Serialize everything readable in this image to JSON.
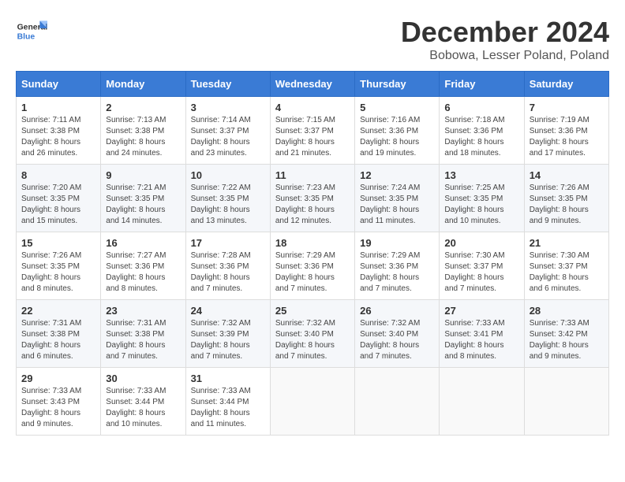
{
  "header": {
    "logo_line1": "General",
    "logo_line2": "Blue",
    "month": "December 2024",
    "location": "Bobowa, Lesser Poland, Poland"
  },
  "weekdays": [
    "Sunday",
    "Monday",
    "Tuesday",
    "Wednesday",
    "Thursday",
    "Friday",
    "Saturday"
  ],
  "weeks": [
    [
      {
        "day": "1",
        "sunrise": "7:11 AM",
        "sunset": "3:38 PM",
        "daylight": "8 hours and 26 minutes."
      },
      {
        "day": "2",
        "sunrise": "7:13 AM",
        "sunset": "3:38 PM",
        "daylight": "8 hours and 24 minutes."
      },
      {
        "day": "3",
        "sunrise": "7:14 AM",
        "sunset": "3:37 PM",
        "daylight": "8 hours and 23 minutes."
      },
      {
        "day": "4",
        "sunrise": "7:15 AM",
        "sunset": "3:37 PM",
        "daylight": "8 hours and 21 minutes."
      },
      {
        "day": "5",
        "sunrise": "7:16 AM",
        "sunset": "3:36 PM",
        "daylight": "8 hours and 19 minutes."
      },
      {
        "day": "6",
        "sunrise": "7:18 AM",
        "sunset": "3:36 PM",
        "daylight": "8 hours and 18 minutes."
      },
      {
        "day": "7",
        "sunrise": "7:19 AM",
        "sunset": "3:36 PM",
        "daylight": "8 hours and 17 minutes."
      }
    ],
    [
      {
        "day": "8",
        "sunrise": "7:20 AM",
        "sunset": "3:35 PM",
        "daylight": "8 hours and 15 minutes."
      },
      {
        "day": "9",
        "sunrise": "7:21 AM",
        "sunset": "3:35 PM",
        "daylight": "8 hours and 14 minutes."
      },
      {
        "day": "10",
        "sunrise": "7:22 AM",
        "sunset": "3:35 PM",
        "daylight": "8 hours and 13 minutes."
      },
      {
        "day": "11",
        "sunrise": "7:23 AM",
        "sunset": "3:35 PM",
        "daylight": "8 hours and 12 minutes."
      },
      {
        "day": "12",
        "sunrise": "7:24 AM",
        "sunset": "3:35 PM",
        "daylight": "8 hours and 11 minutes."
      },
      {
        "day": "13",
        "sunrise": "7:25 AM",
        "sunset": "3:35 PM",
        "daylight": "8 hours and 10 minutes."
      },
      {
        "day": "14",
        "sunrise": "7:26 AM",
        "sunset": "3:35 PM",
        "daylight": "8 hours and 9 minutes."
      }
    ],
    [
      {
        "day": "15",
        "sunrise": "7:26 AM",
        "sunset": "3:35 PM",
        "daylight": "8 hours and 8 minutes."
      },
      {
        "day": "16",
        "sunrise": "7:27 AM",
        "sunset": "3:36 PM",
        "daylight": "8 hours and 8 minutes."
      },
      {
        "day": "17",
        "sunrise": "7:28 AM",
        "sunset": "3:36 PM",
        "daylight": "8 hours and 7 minutes."
      },
      {
        "day": "18",
        "sunrise": "7:29 AM",
        "sunset": "3:36 PM",
        "daylight": "8 hours and 7 minutes."
      },
      {
        "day": "19",
        "sunrise": "7:29 AM",
        "sunset": "3:36 PM",
        "daylight": "8 hours and 7 minutes."
      },
      {
        "day": "20",
        "sunrise": "7:30 AM",
        "sunset": "3:37 PM",
        "daylight": "8 hours and 7 minutes."
      },
      {
        "day": "21",
        "sunrise": "7:30 AM",
        "sunset": "3:37 PM",
        "daylight": "8 hours and 6 minutes."
      }
    ],
    [
      {
        "day": "22",
        "sunrise": "7:31 AM",
        "sunset": "3:38 PM",
        "daylight": "8 hours and 6 minutes."
      },
      {
        "day": "23",
        "sunrise": "7:31 AM",
        "sunset": "3:38 PM",
        "daylight": "8 hours and 7 minutes."
      },
      {
        "day": "24",
        "sunrise": "7:32 AM",
        "sunset": "3:39 PM",
        "daylight": "8 hours and 7 minutes."
      },
      {
        "day": "25",
        "sunrise": "7:32 AM",
        "sunset": "3:40 PM",
        "daylight": "8 hours and 7 minutes."
      },
      {
        "day": "26",
        "sunrise": "7:32 AM",
        "sunset": "3:40 PM",
        "daylight": "8 hours and 7 minutes."
      },
      {
        "day": "27",
        "sunrise": "7:33 AM",
        "sunset": "3:41 PM",
        "daylight": "8 hours and 8 minutes."
      },
      {
        "day": "28",
        "sunrise": "7:33 AM",
        "sunset": "3:42 PM",
        "daylight": "8 hours and 9 minutes."
      }
    ],
    [
      {
        "day": "29",
        "sunrise": "7:33 AM",
        "sunset": "3:43 PM",
        "daylight": "8 hours and 9 minutes."
      },
      {
        "day": "30",
        "sunrise": "7:33 AM",
        "sunset": "3:44 PM",
        "daylight": "8 hours and 10 minutes."
      },
      {
        "day": "31",
        "sunrise": "7:33 AM",
        "sunset": "3:44 PM",
        "daylight": "8 hours and 11 minutes."
      },
      null,
      null,
      null,
      null
    ]
  ]
}
